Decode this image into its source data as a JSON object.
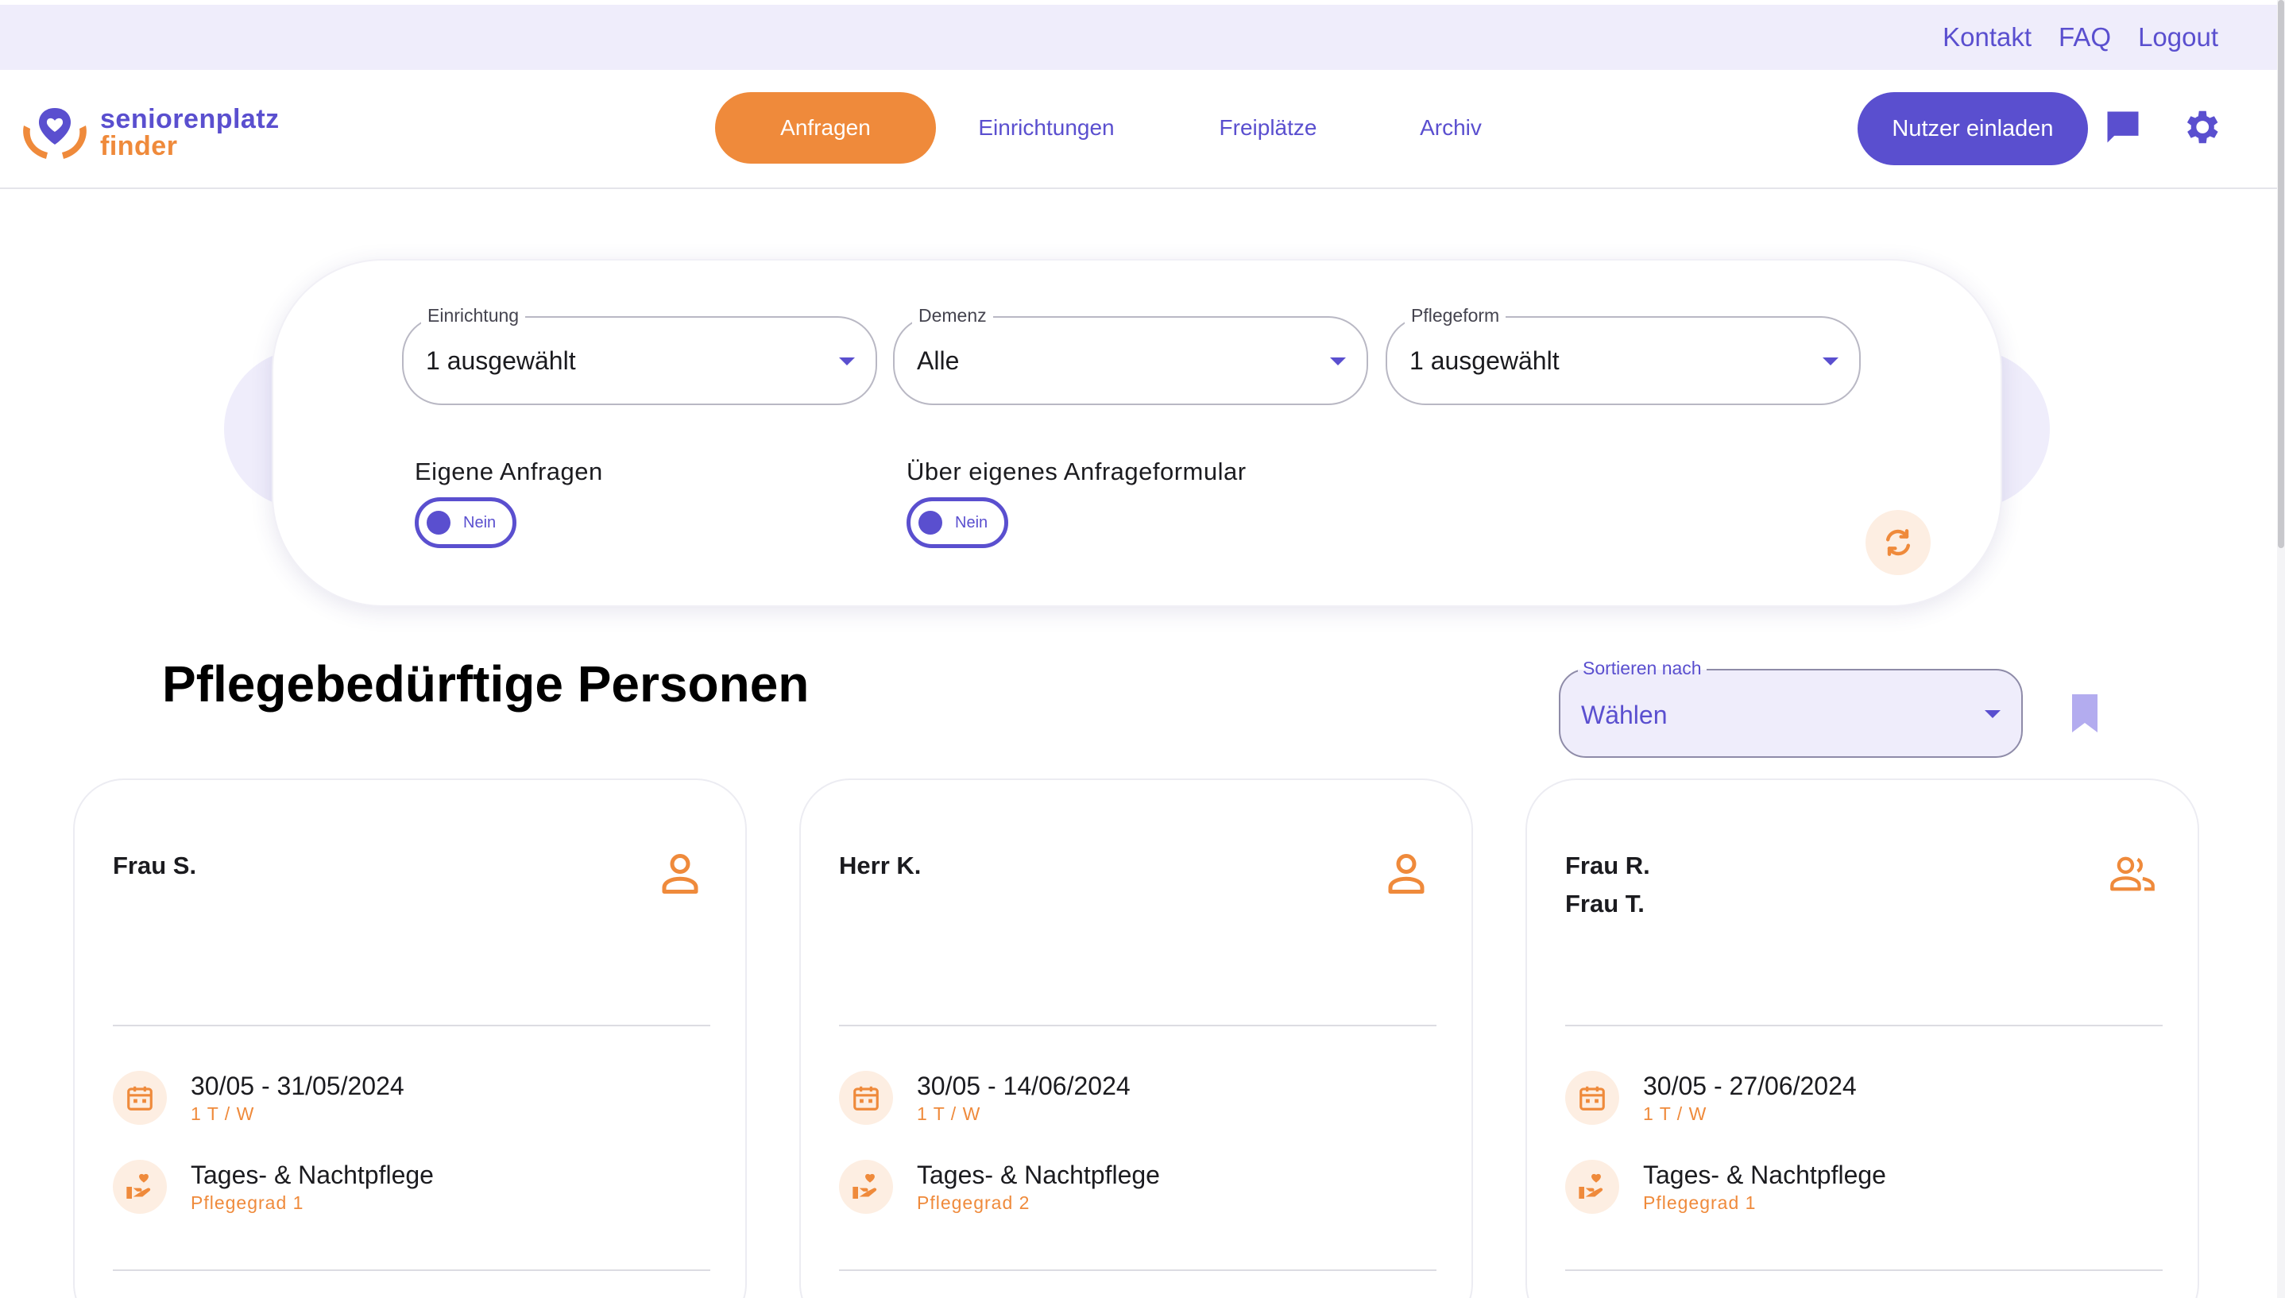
{
  "topbar": {
    "links": [
      "Kontakt",
      "FAQ",
      "Logout"
    ]
  },
  "logo": {
    "line1": "seniorenplatz",
    "line2": "finder"
  },
  "nav": {
    "items": [
      "Anfragen",
      "Einrichtungen",
      "Freiplätze",
      "Archiv"
    ],
    "active": "Anfragen"
  },
  "header": {
    "invite_label": "Nutzer einladen",
    "chat_icon": "chat-icon",
    "settings_icon": "gear-icon"
  },
  "filters": {
    "einrichtung": {
      "label": "Einrichtung",
      "value": "1 ausgewählt"
    },
    "demenz": {
      "label": "Demenz",
      "value": "Alle"
    },
    "pflegeform": {
      "label": "Pflegeform",
      "value": "1 ausgewählt"
    },
    "eigene_anfragen": {
      "label": "Eigene Anfragen",
      "state": "Nein"
    },
    "anfrageformular": {
      "label": "Über eigenes Anfrageformular",
      "state": "Nein"
    },
    "reset_icon": "refresh-icon"
  },
  "section": {
    "title": "Pflegebedürftige Personen",
    "sort": {
      "label": "Sortieren nach",
      "value": "Wählen"
    }
  },
  "cards": [
    {
      "name": "Frau S.",
      "name2": "",
      "icon": "person-icon",
      "date_range": "30/05 - 31/05/2024",
      "frequency": "1 T / W",
      "care_type": "Tages- & Nachtpflege",
      "care_level": "Pflegegrad 1"
    },
    {
      "name": "Herr K.",
      "name2": "",
      "icon": "person-icon",
      "date_range": "30/05 - 14/06/2024",
      "frequency": "1 T / W",
      "care_type": "Tages- & Nachtpflege",
      "care_level": "Pflegegrad 2"
    },
    {
      "name": "Frau R.",
      "name2": "Frau T.",
      "icon": "people-icon",
      "date_range": "30/05 - 27/06/2024",
      "frequency": "1 T / W",
      "care_type": "Tages- & Nachtpflege",
      "care_level": "Pflegegrad 1"
    }
  ],
  "colors": {
    "brand_purple": "#5a4fcf",
    "brand_orange": "#ef8a3b",
    "soft_purple": "#efedfb",
    "soft_orange": "#fdeee2"
  }
}
